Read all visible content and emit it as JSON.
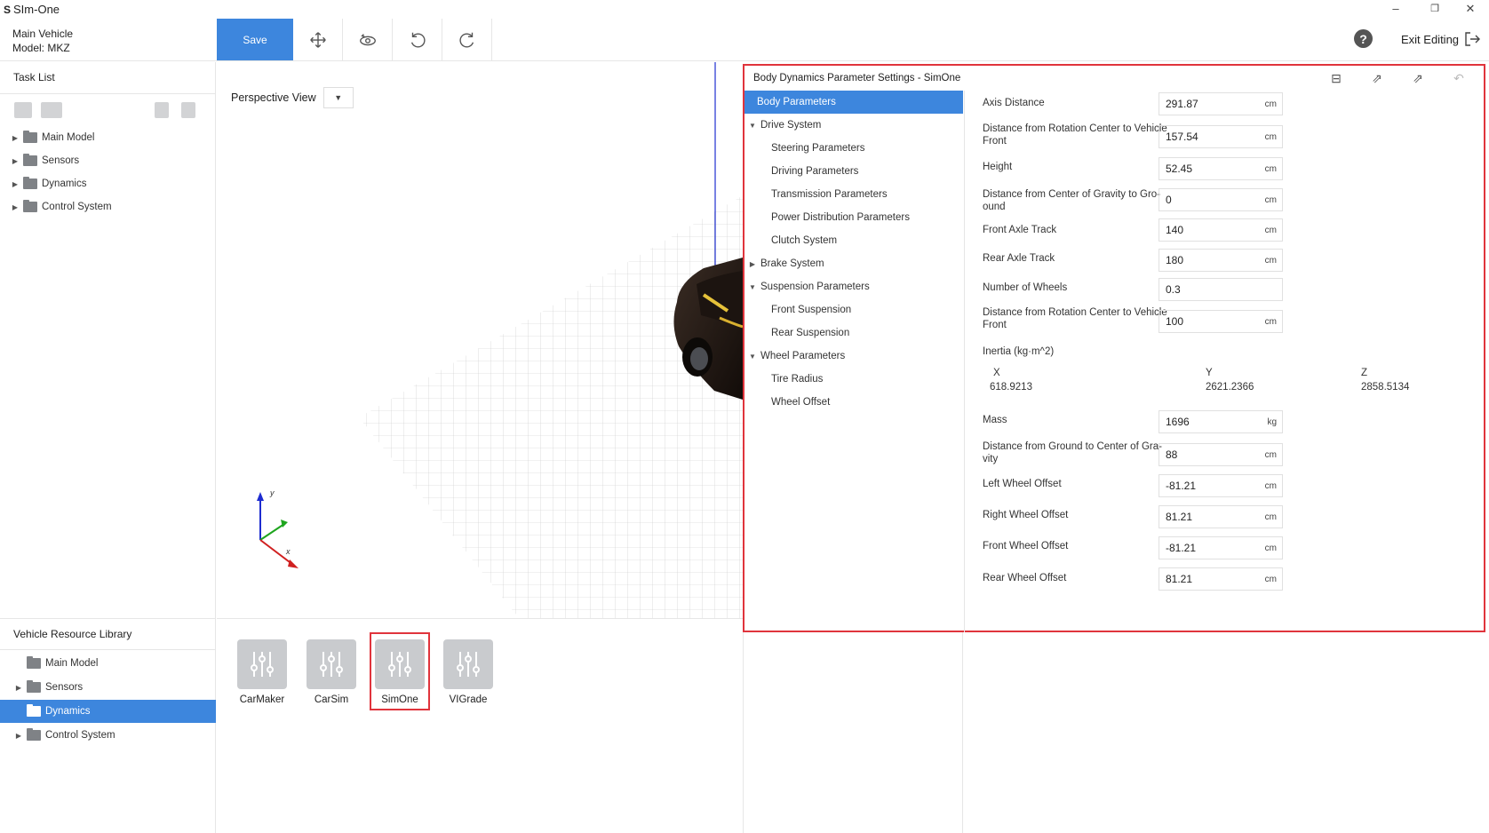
{
  "app": {
    "title": "SIm-One",
    "logo": "S"
  },
  "window_controls": [
    "minimize-icon",
    "restore-icon",
    "close-icon"
  ],
  "vehicle": {
    "line1": "Main Vehicle",
    "line2": "Model: MKZ"
  },
  "toolbar": {
    "save_label": "Save",
    "tools": [
      "move-icon",
      "orbit-icon",
      "undo-icon",
      "redo-icon"
    ],
    "help": "?",
    "exit_label": "Exit Editing"
  },
  "task_list": {
    "title": "Task List",
    "items": [
      {
        "label": "Main Model"
      },
      {
        "label": "Sensors"
      },
      {
        "label": "Dynamics"
      },
      {
        "label": "Control System"
      }
    ]
  },
  "viewport": {
    "view_label": "Perspective View",
    "axes": {
      "y": "y",
      "x": "x"
    }
  },
  "library": {
    "title": "Vehicle Resource Library",
    "items": [
      {
        "label": "Main Model"
      },
      {
        "label": "Sensors"
      },
      {
        "label": "Dynamics"
      },
      {
        "label": "Control System"
      }
    ],
    "cards": [
      {
        "label": "CarMaker"
      },
      {
        "label": "CarSim"
      },
      {
        "label": "SimOne"
      },
      {
        "label": "VIGrade"
      }
    ],
    "selected_card": "SimOne"
  },
  "params": {
    "title": "Body Dynamics Parameter Settings - SimOne",
    "nav": [
      {
        "label": "Body Parameters",
        "level": "top",
        "active": true
      },
      {
        "label": "Drive System",
        "level": "group"
      },
      {
        "label": "Steering Parameters",
        "level": "sub"
      },
      {
        "label": "Driving Parameters",
        "level": "sub"
      },
      {
        "label": "Transmission Parameters",
        "level": "sub"
      },
      {
        "label": "Power Distribution Parameters",
        "level": "sub"
      },
      {
        "label": "Clutch System",
        "level": "sub"
      },
      {
        "label": "Brake System",
        "level": "group"
      },
      {
        "label": "Suspension Parameters",
        "level": "group"
      },
      {
        "label": "Front Suspension",
        "level": "sub"
      },
      {
        "label": "Rear Suspension",
        "level": "sub"
      },
      {
        "label": "Wheel Parameters",
        "level": "group"
      },
      {
        "label": "Tire Radius",
        "level": "sub"
      },
      {
        "label": "Wheel Offset",
        "level": "sub"
      }
    ],
    "fields": [
      {
        "label": "Axis Distance",
        "value": "291.87",
        "unit": "cm"
      },
      {
        "label": "Distance from Rotation Center to Vehicle Front",
        "value": "157.54",
        "unit": "cm"
      },
      {
        "label": "Height",
        "value": "52.45",
        "unit": "cm"
      },
      {
        "label": "Distance from Center of Gravity to Gro-ound",
        "value": "0",
        "unit": "cm"
      },
      {
        "label": "Front Axle Track",
        "value": "140",
        "unit": "cm"
      },
      {
        "label": "Rear Axle Track",
        "value": "180",
        "unit": "cm"
      },
      {
        "label": "Number of Wheels",
        "value": "0.3",
        "unit": ""
      },
      {
        "label": "Distance from Rotation Center to Vehicle Front",
        "value": "100",
        "unit": "cm"
      },
      {
        "label": "Mass",
        "value": "1696",
        "unit": "kg"
      },
      {
        "label": "Distance from Ground to Center of Gra-vity",
        "value": "88",
        "unit": "cm"
      },
      {
        "label": "Left Wheel Offset",
        "value": "-81.21",
        "unit": "cm"
      },
      {
        "label": "Right Wheel Offset",
        "value": "81.21",
        "unit": "cm"
      },
      {
        "label": "Front Wheel Offset",
        "value": "-81.21",
        "unit": "cm"
      },
      {
        "label": "Rear Wheel Offset",
        "value": "81.21",
        "unit": "cm"
      }
    ],
    "inertia": {
      "label": "Inertia (kg·m^2)",
      "x_label": "X",
      "x": "618.9213",
      "y_label": "Y",
      "y": "2621.2366",
      "z_label": "Z",
      "z": "2858.5134"
    }
  },
  "colors": {
    "accent": "#3d86dd",
    "highlight": "#e0343c"
  }
}
